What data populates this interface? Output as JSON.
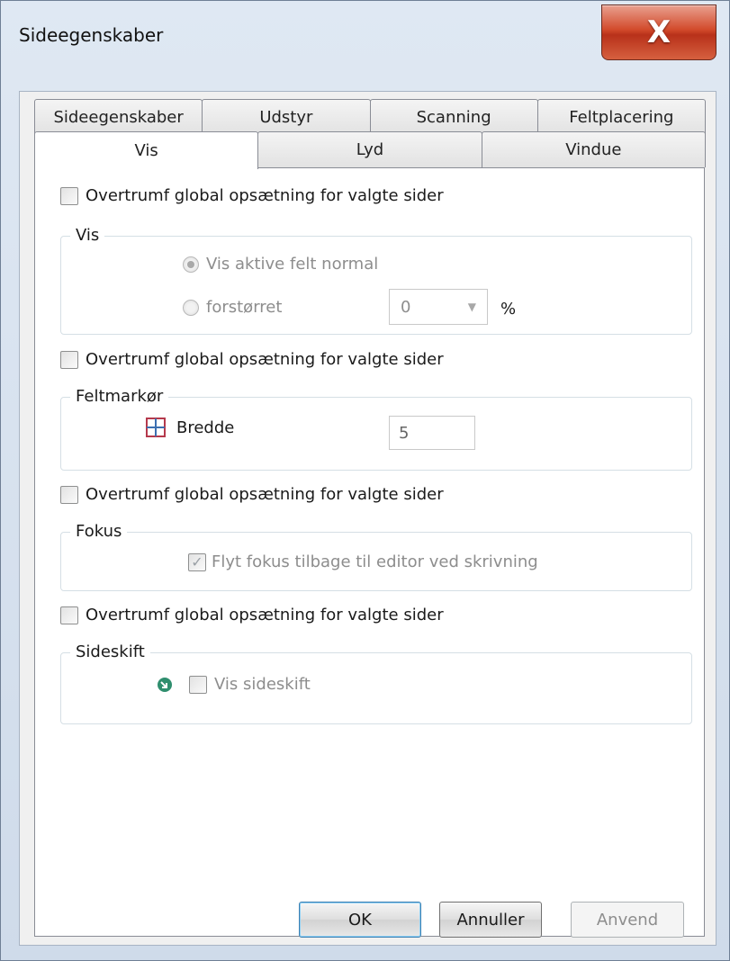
{
  "window": {
    "title": "Sideegenskaber",
    "close_glyph": "X"
  },
  "tabs": {
    "back_row": [
      "Sideegenskaber",
      "Udstyr",
      "Scanning",
      "Feltplacering"
    ],
    "front_row": [
      "Vis",
      "Lyd",
      "Vindue"
    ],
    "active": "Vis"
  },
  "override_label": "Overtrumf global opsætning for valgte sider",
  "groups": {
    "vis": {
      "label": "Vis",
      "radio_normal": "Vis aktive felt normal",
      "radio_enlarged": "forstørret",
      "zoom_value": "0",
      "percent": "%"
    },
    "feltmarkor": {
      "label": "Feltmarkør",
      "width_label": "Bredde",
      "width_value": "5"
    },
    "fokus": {
      "label": "Fokus",
      "checkbox_label": "Flyt fokus tilbage til editor ved skrivning",
      "check_glyph": "✓"
    },
    "sideskift": {
      "label": "Sideskift",
      "checkbox_label": "Vis sideskift"
    }
  },
  "buttons": {
    "ok": "OK",
    "cancel": "Annuller",
    "apply": "Anvend"
  },
  "colors": {
    "accent": "#3c7fb1",
    "close": "#c8462a",
    "disabled_text": "#8d8d8d"
  },
  "icons": [
    "close-icon",
    "grid-icon",
    "page-break-icon",
    "checkmark-icon",
    "dropdown-arrow-icon"
  ]
}
